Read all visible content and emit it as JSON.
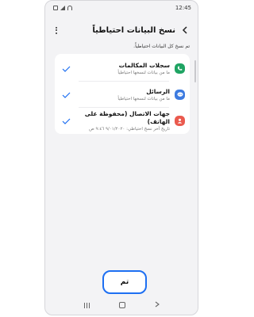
{
  "status_bar": {
    "time": "12:45"
  },
  "header": {
    "title": "نسخ البيانات احتياطياً",
    "back_icon": "chevron-left-icon",
    "menu_icon": "more-vertical-icon"
  },
  "subtitle": "تم نسخ كل البيانات احتياطياً.",
  "items": [
    {
      "title": "سجلات المكالمات",
      "subtitle": "ما من بيانات لنسخها احتياطياً",
      "icon": "phone-icon",
      "color": "#1fa463",
      "glyph": "✆"
    },
    {
      "title": "الرسائل",
      "subtitle": "ما من بيانات لنسخها احتياطياً",
      "icon": "message-icon",
      "color": "#3d7be0",
      "glyph": "•••"
    },
    {
      "title": "جهات الاتصال (محفوظة على الهاتف)",
      "subtitle": "تاريخ آخر نسخ احتياطي: ٩/٠١/٢٠٢٠ ٩:٤٦ ص",
      "icon": "contact-icon",
      "color": "#ea5a4e",
      "glyph": "●"
    }
  ],
  "done_button": {
    "label": "تم"
  },
  "accent_color": "#1d6ff2"
}
